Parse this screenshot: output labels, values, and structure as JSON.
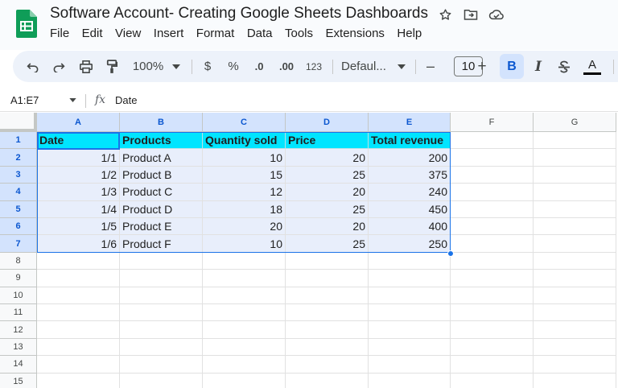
{
  "app": {
    "doc_title": "Software Account- Creating Google Sheets Dashboards",
    "menu": [
      "File",
      "Edit",
      "View",
      "Insert",
      "Format",
      "Data",
      "Tools",
      "Extensions",
      "Help"
    ],
    "title_icons": [
      "star-icon",
      "move-to-folder-icon",
      "cloud-saved-icon"
    ]
  },
  "toolbar": {
    "zoom": "100%",
    "currency": "$",
    "percent": "%",
    "decrease_decimal": ".0",
    "increase_decimal": ".00",
    "number_format": "123",
    "font": "Defaul...",
    "font_size": "10",
    "minus": "–",
    "plus": "+",
    "bold": "B",
    "italic": "I",
    "text_color_letter": "A",
    "icons": [
      "undo-icon",
      "redo-icon",
      "print-icon",
      "paint-format-icon",
      "strikethrough-icon",
      "text-color-icon"
    ]
  },
  "formula_bar": {
    "name_box": "A1:E7",
    "fx": "fx",
    "value": "Date"
  },
  "sheet": {
    "columns": [
      "A",
      "B",
      "C",
      "D",
      "E",
      "F",
      "G"
    ],
    "rows": [
      "1",
      "2",
      "3",
      "4",
      "5",
      "6",
      "7",
      "8",
      "9",
      "10",
      "11",
      "12",
      "13",
      "14",
      "15"
    ],
    "header": [
      "Date",
      "Products",
      "Quantity sold",
      "Price",
      "Total revenue"
    ],
    "data": [
      [
        "1/1",
        "Product  A",
        "10",
        "20",
        "200"
      ],
      [
        "1/2",
        "Product  B",
        "15",
        "25",
        "375"
      ],
      [
        "1/3",
        "Product  C",
        "12",
        "20",
        "240"
      ],
      [
        "1/4",
        "Product  D",
        "18",
        "25",
        "450"
      ],
      [
        "1/5",
        "Product  E",
        "20",
        "20",
        "400"
      ],
      [
        "1/6",
        "Product  F",
        "10",
        "25",
        "250"
      ]
    ],
    "colors": {
      "header_fill": "#00e5ff",
      "selection_fill": "#e8eefb",
      "selection_border": "#1a73e8"
    }
  }
}
